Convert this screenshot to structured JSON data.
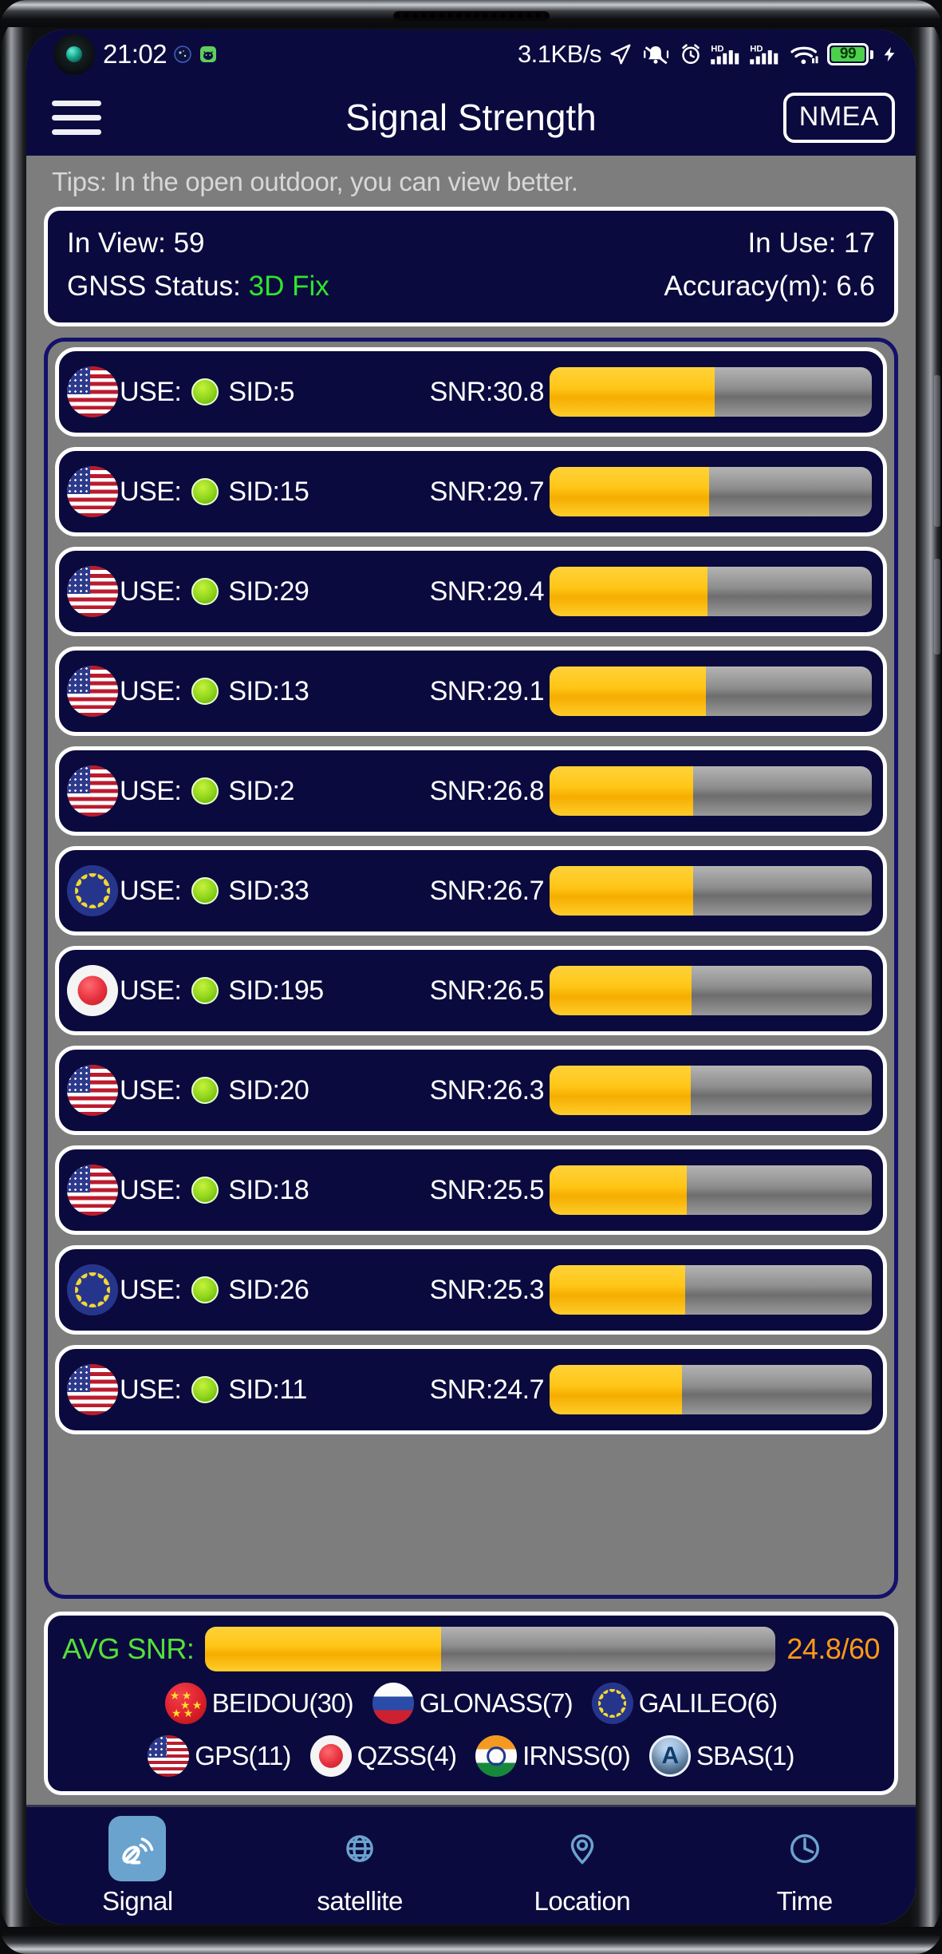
{
  "status_bar": {
    "time": "21:02",
    "net_speed": "3.1KB/s",
    "battery_level": "99",
    "icons": [
      "camera-punch-hole",
      "galaxy-app-icon",
      "android-mascot-icon",
      "location-arrow-icon",
      "bell-muted-icon",
      "alarm-clock-icon",
      "hd-signal-1-icon",
      "hd-signal-2-icon",
      "wifi-icon",
      "battery-icon",
      "charging-bolt-icon"
    ]
  },
  "app_bar": {
    "title": "Signal Strength",
    "menu_icon": "hamburger-menu-icon",
    "nmea_label": "NMEA"
  },
  "tips": "Tips: In the open outdoor, you can view better.",
  "info_card": {
    "in_view_label": "In View: 59",
    "in_use_label": "In Use: 17",
    "gnss_status_label": "GNSS Status:",
    "gnss_status_value": "3D Fix",
    "accuracy_label": "Accuracy(m): 6.6"
  },
  "satellites": {
    "use_text": "USE:",
    "snr_max": 60,
    "rows": [
      {
        "flag": "us",
        "use": "USE:",
        "sid": "SID:5",
        "snr": "SNR:30.8",
        "snr_value": 30.8
      },
      {
        "flag": "us",
        "use": "USE:",
        "sid": "SID:15",
        "snr": "SNR:29.7",
        "snr_value": 29.7
      },
      {
        "flag": "us",
        "use": "USE:",
        "sid": "SID:29",
        "snr": "SNR:29.4",
        "snr_value": 29.4
      },
      {
        "flag": "us",
        "use": "USE:",
        "sid": "SID:13",
        "snr": "SNR:29.1",
        "snr_value": 29.1
      },
      {
        "flag": "us",
        "use": "USE:",
        "sid": "SID:2",
        "snr": "SNR:26.8",
        "snr_value": 26.8
      },
      {
        "flag": "eu",
        "use": "USE:",
        "sid": "SID:33",
        "snr": "SNR:26.7",
        "snr_value": 26.7
      },
      {
        "flag": "jp",
        "use": "USE:",
        "sid": "SID:195",
        "snr": "SNR:26.5",
        "snr_value": 26.5
      },
      {
        "flag": "us",
        "use": "USE:",
        "sid": "SID:20",
        "snr": "SNR:26.3",
        "snr_value": 26.3
      },
      {
        "flag": "us",
        "use": "USE:",
        "sid": "SID:18",
        "snr": "SNR:25.5",
        "snr_value": 25.5
      },
      {
        "flag": "eu",
        "use": "USE:",
        "sid": "SID:26",
        "snr": "SNR:25.3",
        "snr_value": 25.3
      },
      {
        "flag": "us",
        "use": "USE:",
        "sid": "SID:11",
        "snr": "SNR:24.7",
        "snr_value": 24.7
      }
    ]
  },
  "avg_card": {
    "label": "AVG SNR:",
    "value": "24.8/60",
    "value_number": 24.8,
    "max": 60,
    "constellations_row1": [
      {
        "flag": "cn",
        "label": "BEIDOU(30)"
      },
      {
        "flag": "ru",
        "label": "GLONASS(7)"
      },
      {
        "flag": "eu",
        "label": "GALILEO(6)"
      }
    ],
    "constellations_row2": [
      {
        "flag": "us",
        "label": "GPS(11)"
      },
      {
        "flag": "jp",
        "label": "QZSS(4)"
      },
      {
        "flag": "in",
        "label": "IRNSS(0)"
      },
      {
        "flag": "sbas",
        "label": "SBAS(1)"
      }
    ]
  },
  "bottom_nav": [
    {
      "icon": "signal-antenna-icon",
      "label": "Signal",
      "active": true
    },
    {
      "icon": "globe-satellite-icon",
      "label": "satellite",
      "active": false
    },
    {
      "icon": "location-pin-icon",
      "label": "Location",
      "active": false
    },
    {
      "icon": "clock-icon",
      "label": "Time",
      "active": false
    }
  ],
  "colors": {
    "screen_bg": "#7d7d7d",
    "panel_navy": "#0b0a3e",
    "accent_yellow": "#ffc617",
    "accent_green": "#2ee62e",
    "accent_orange": "#ff9a18",
    "nav_active": "#6ba3cf"
  }
}
